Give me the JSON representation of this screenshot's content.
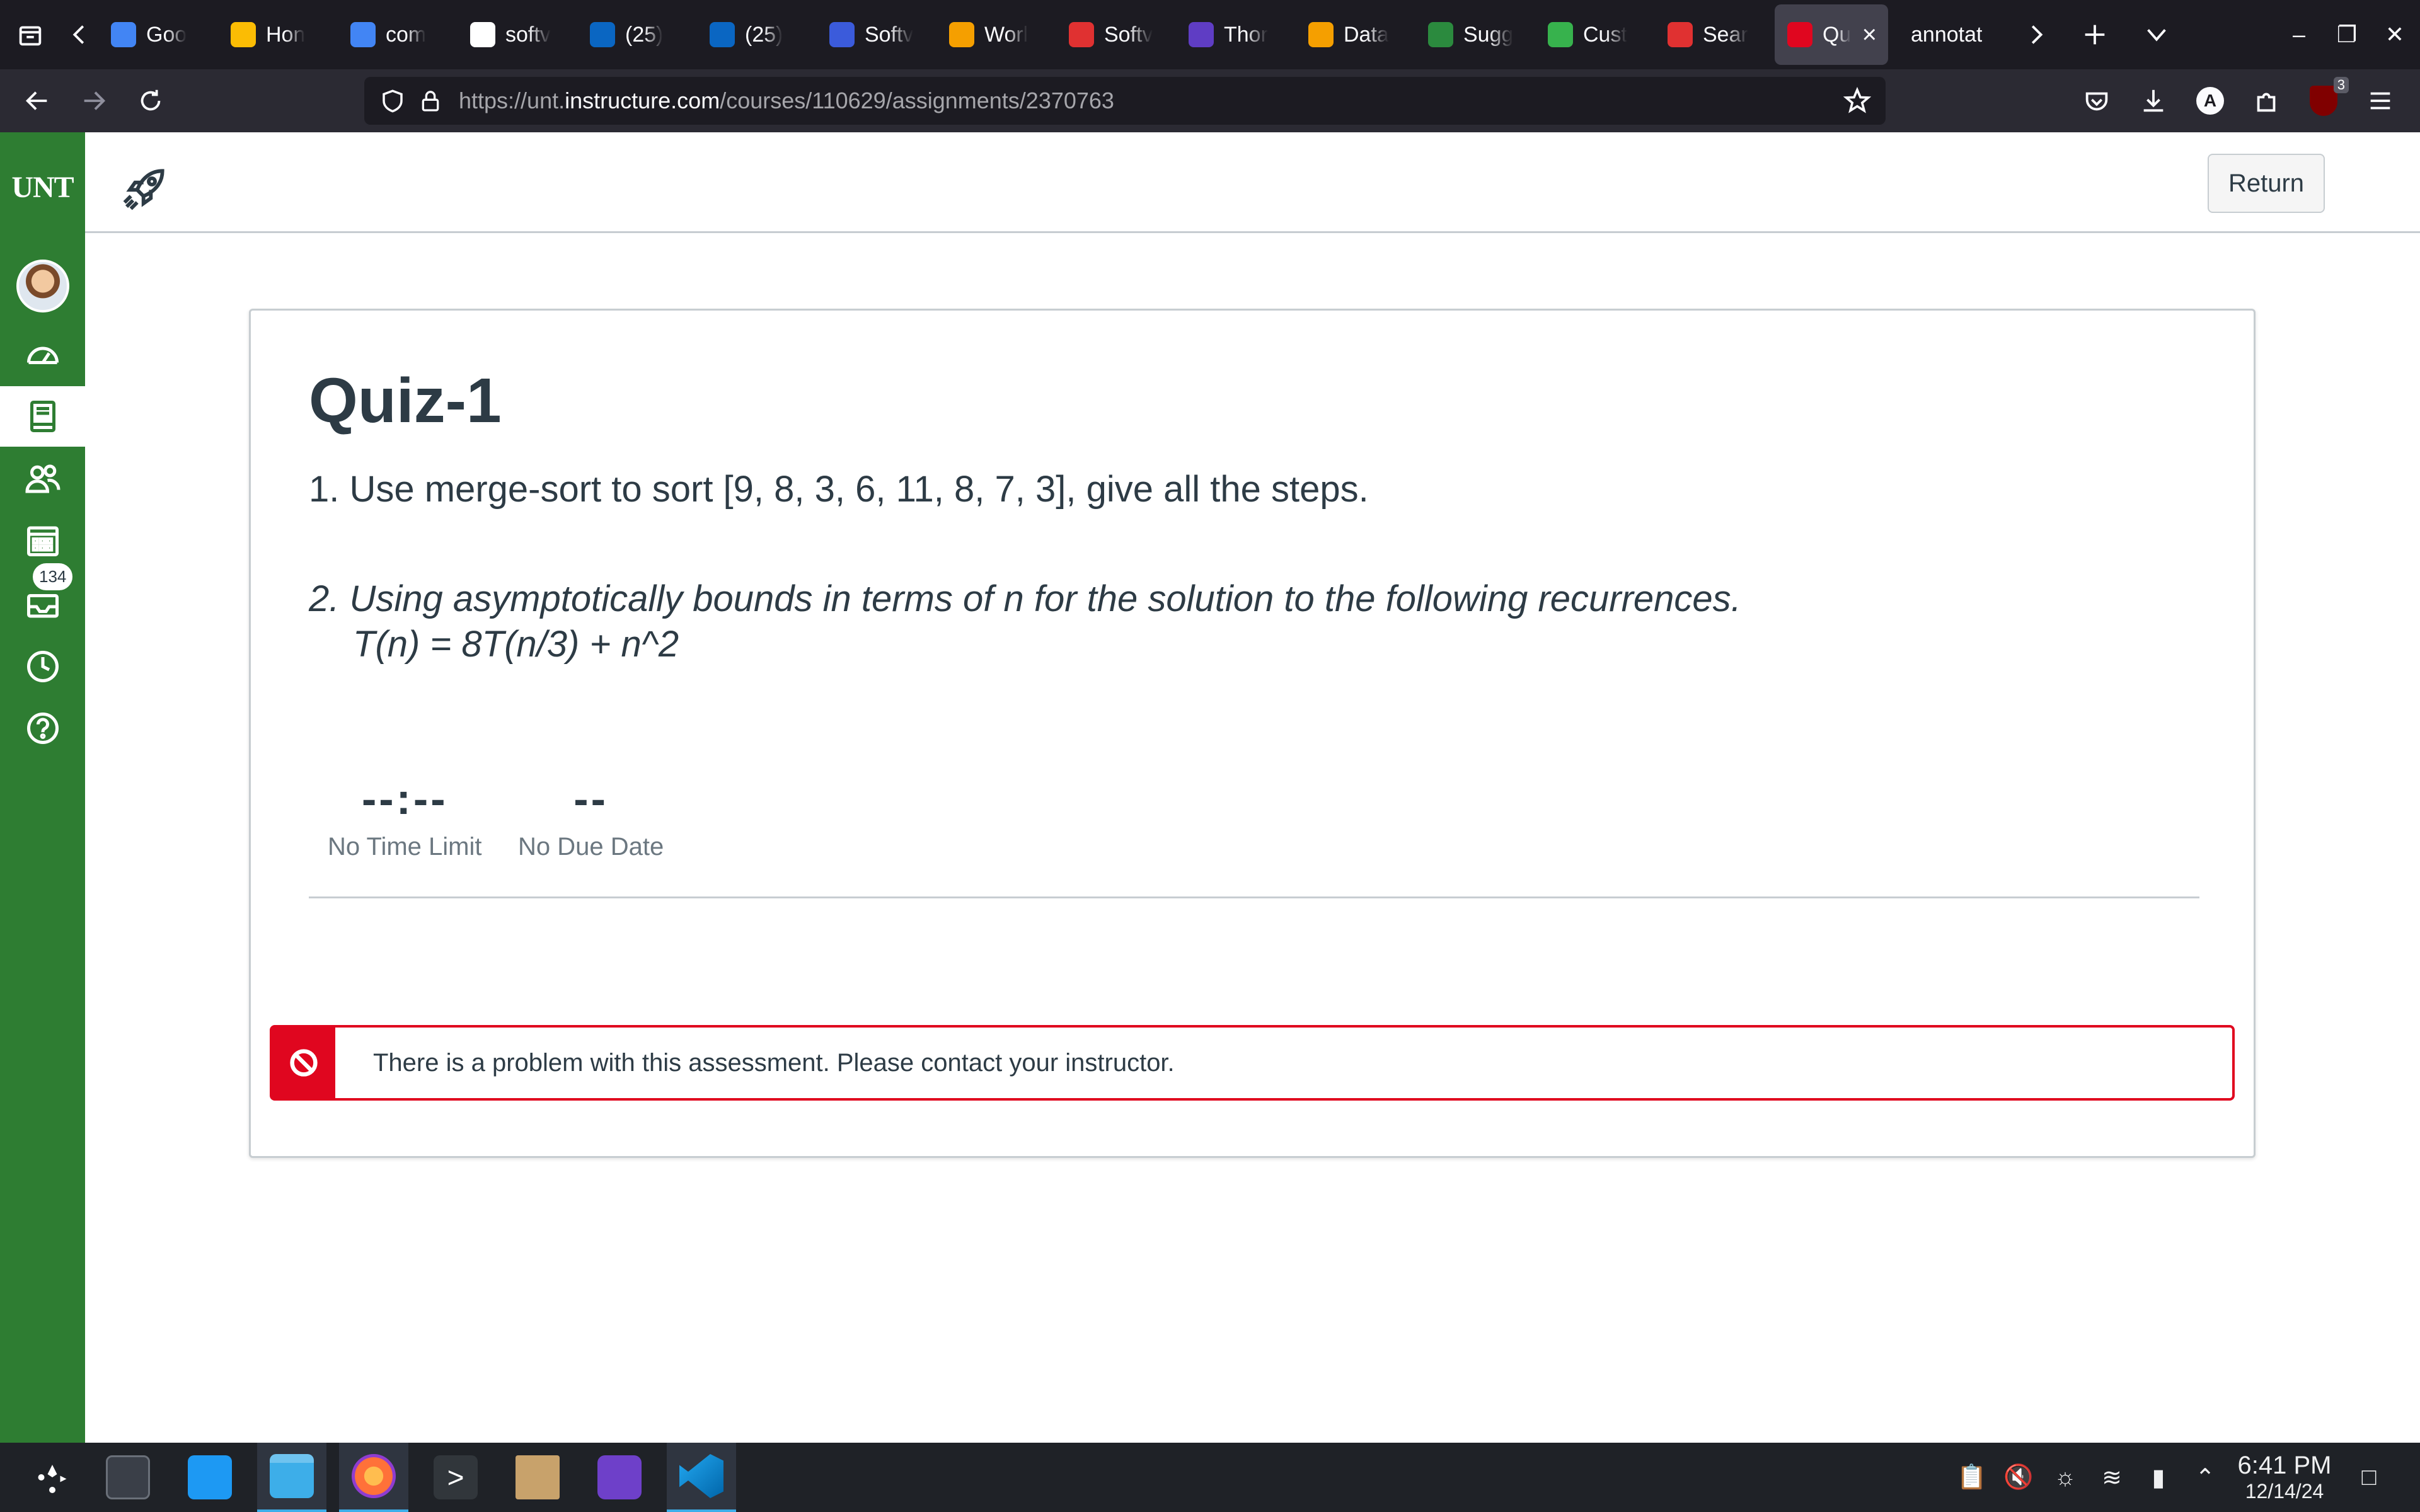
{
  "browser": {
    "tabs": [
      {
        "label": "Goo",
        "favicon": "docs-icon",
        "color": "#4285f4"
      },
      {
        "label": "Hon",
        "favicon": "drive-icon",
        "color": "#fbbc04"
      },
      {
        "label": "com",
        "favicon": "docs-icon",
        "color": "#4285f4"
      },
      {
        "label": "softv",
        "favicon": "google-icon",
        "color": "#ffffff"
      },
      {
        "label": "(25)",
        "favicon": "linkedin-icon",
        "color": "#0a66c2"
      },
      {
        "label": "(25)",
        "favicon": "linkedin-icon",
        "color": "#0a66c2"
      },
      {
        "label": "Softv",
        "favicon": "globe-icon",
        "color": "#3b5bdb"
      },
      {
        "label": "Worl",
        "favicon": "w-icon",
        "color": "#f59f00"
      },
      {
        "label": "Softv",
        "favicon": "d-icon",
        "color": "#e03131"
      },
      {
        "label": "Thor",
        "favicon": "jobs-icon",
        "color": "#5f3dc4"
      },
      {
        "label": "Data",
        "favicon": "w-icon",
        "color": "#f59f00"
      },
      {
        "label": "Sugg",
        "favicon": "mic-icon",
        "color": "#2b8a3e"
      },
      {
        "label": "Cust",
        "favicon": "star-icon",
        "color": "#37b24d"
      },
      {
        "label": "Sear",
        "favicon": "search-brand-icon",
        "color": "#e03131"
      }
    ],
    "active_tab": {
      "label": "Qu",
      "favicon": "canvas-icon",
      "color": "#e0061f"
    },
    "overflow_tab": {
      "label": "annotat"
    },
    "url_prefix": "https://unt.",
    "url_host": "instructure.com",
    "url_path": "/courses/110629/assignments/2370763",
    "extension_badge": "3"
  },
  "canvas": {
    "logo": "UNT",
    "inbox_badge": "134",
    "header": {
      "return_label": "Return"
    },
    "quiz": {
      "title": "Quiz-1",
      "question1": "1. Use merge-sort to sort [9, 8, 3, 6, 11, 8, 7, 3], give all the steps.",
      "question2": "2. Using asymptotically bounds in terms of n for the solution to the following recurrences.",
      "question2_equation": "T(n) = 8T(n/3) + n^2",
      "time_value": "--:--",
      "time_label": "No Time Limit",
      "due_value": "--",
      "due_label": "No Due Date",
      "alert_message": "There is a problem with this assessment. Please contact your instructor."
    },
    "colors": {
      "nav_green": "#2e7d32",
      "alert_red": "#e0061f",
      "text": "#2d3b45"
    }
  },
  "taskbar": {
    "time": "6:41 PM",
    "date": "12/14/24"
  }
}
